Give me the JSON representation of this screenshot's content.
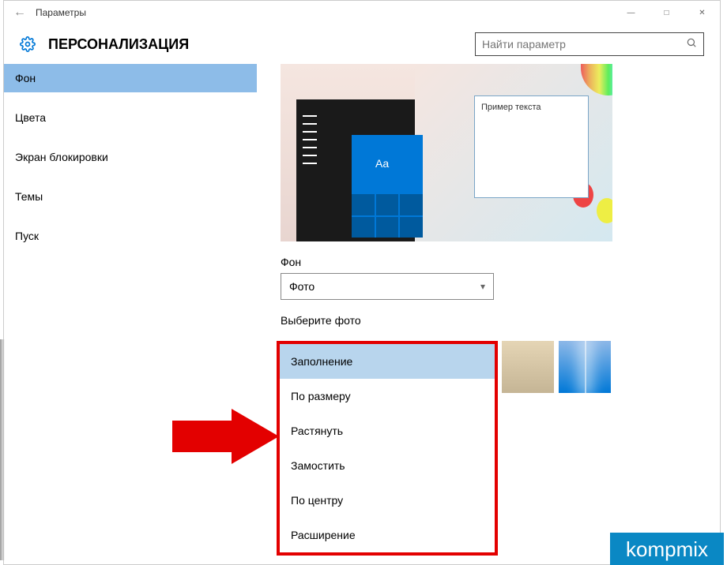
{
  "titlebar": {
    "title": "Параметры"
  },
  "header": {
    "title": "ПЕРСОНАЛИЗАЦИЯ"
  },
  "search": {
    "placeholder": "Найти параметр"
  },
  "sidebar": {
    "items": [
      {
        "label": "Фон",
        "selected": true
      },
      {
        "label": "Цвета"
      },
      {
        "label": "Экран блокировки"
      },
      {
        "label": "Темы"
      },
      {
        "label": "Пуск"
      }
    ]
  },
  "content": {
    "preview": {
      "sample_text": "Пример текста",
      "tile_text": "Aa"
    },
    "bg_label": "Фон",
    "bg_dropdown_value": "Фото",
    "choose_photo_label": "Выберите фото",
    "fit_menu": {
      "items": [
        {
          "label": "Заполнение",
          "hovered": true
        },
        {
          "label": "По размеру"
        },
        {
          "label": "Растянуть"
        },
        {
          "label": "Замостить"
        },
        {
          "label": "По центру"
        },
        {
          "label": "Расширение"
        }
      ]
    }
  },
  "watermark": "kompmix"
}
